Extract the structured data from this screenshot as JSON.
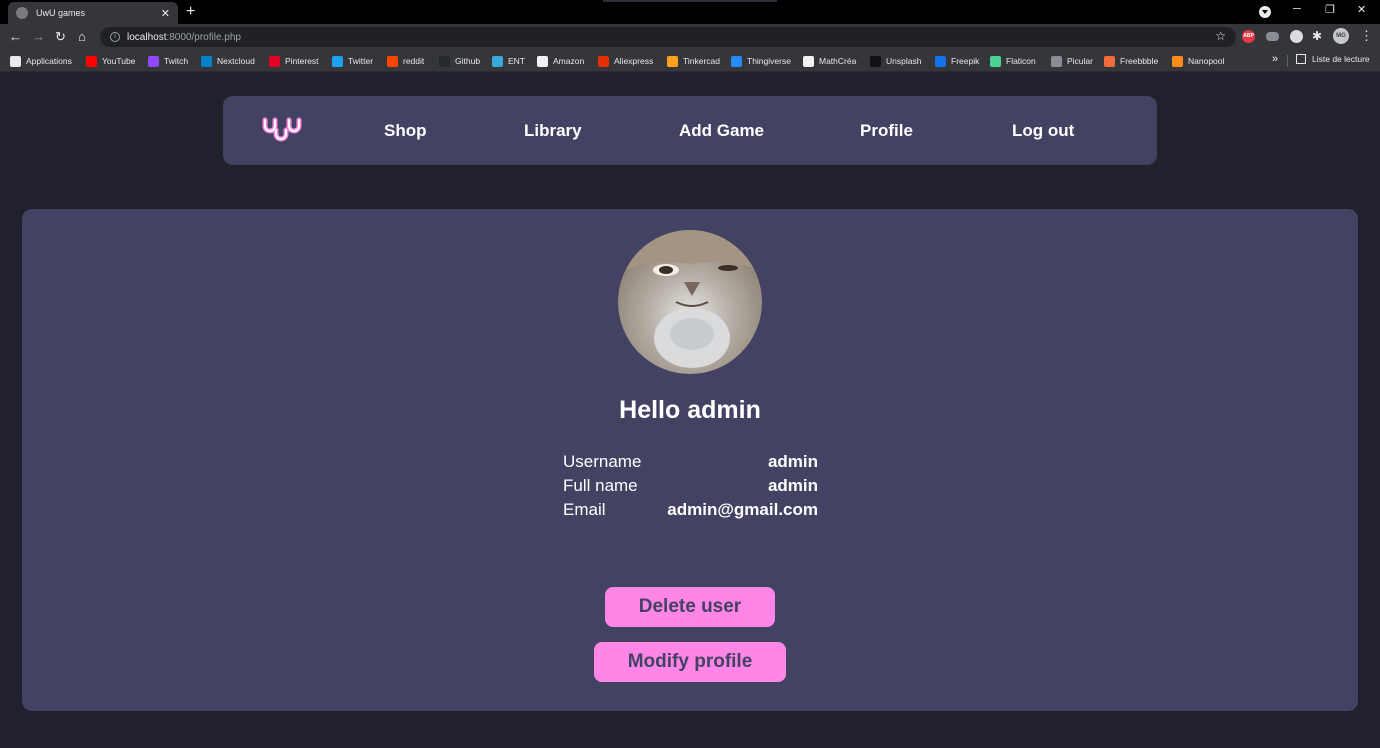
{
  "browser": {
    "tab_title": "UwU games",
    "url_host": "localhost",
    "url_rest": ":8000/profile.php",
    "extensions": {
      "abp_label": "ABP",
      "avatar_initials": "MG"
    },
    "bookmarks": [
      {
        "label": "Applications",
        "color": "#e8eaed"
      },
      {
        "label": "YouTube",
        "color": "#ff0000"
      },
      {
        "label": "Twitch",
        "color": "#9146ff"
      },
      {
        "label": "Nextcloud",
        "color": "#0082c9"
      },
      {
        "label": "Pinterest",
        "color": "#e60023"
      },
      {
        "label": "Twitter",
        "color": "#1da1f2"
      },
      {
        "label": "reddit",
        "color": "#ff4500"
      },
      {
        "label": "Github",
        "color": "#24292e"
      },
      {
        "label": "ENT",
        "color": "#3aa8d8"
      },
      {
        "label": "Amazon",
        "color": "#f2f2f2"
      },
      {
        "label": "Aliexpress",
        "color": "#e62e04"
      },
      {
        "label": "Tinkercad",
        "color": "#ff9f1c"
      },
      {
        "label": "Thingiverse",
        "color": "#248bfb"
      },
      {
        "label": "MathCréa",
        "color": "#f2f2f2"
      },
      {
        "label": "Unsplash",
        "color": "#111111"
      },
      {
        "label": "Freepik",
        "color": "#1273eb"
      },
      {
        "label": "Flaticon",
        "color": "#4ad295"
      },
      {
        "label": "Picular",
        "color": "#8a8d93"
      },
      {
        "label": "Freebbble",
        "color": "#f06b3c"
      },
      {
        "label": "Nanopool",
        "color": "#ff8c1a"
      }
    ],
    "reading_list": "Liste de lecture"
  },
  "nav": {
    "logo": "UwU",
    "links": [
      "Shop",
      "Library",
      "Add Game",
      "Profile",
      "Log out"
    ]
  },
  "profile": {
    "greeting": "Hello admin",
    "fields": [
      {
        "label": "Username",
        "value": "admin"
      },
      {
        "label": "Full name",
        "value": "admin"
      },
      {
        "label": "Email",
        "value": "admin@gmail.com"
      }
    ]
  },
  "actions": {
    "delete": "Delete user",
    "modify": "Modify profile"
  },
  "colors": {
    "background": "#20212d",
    "panel": "#434263",
    "accent": "#ff85e6",
    "text": "#ffffff"
  }
}
